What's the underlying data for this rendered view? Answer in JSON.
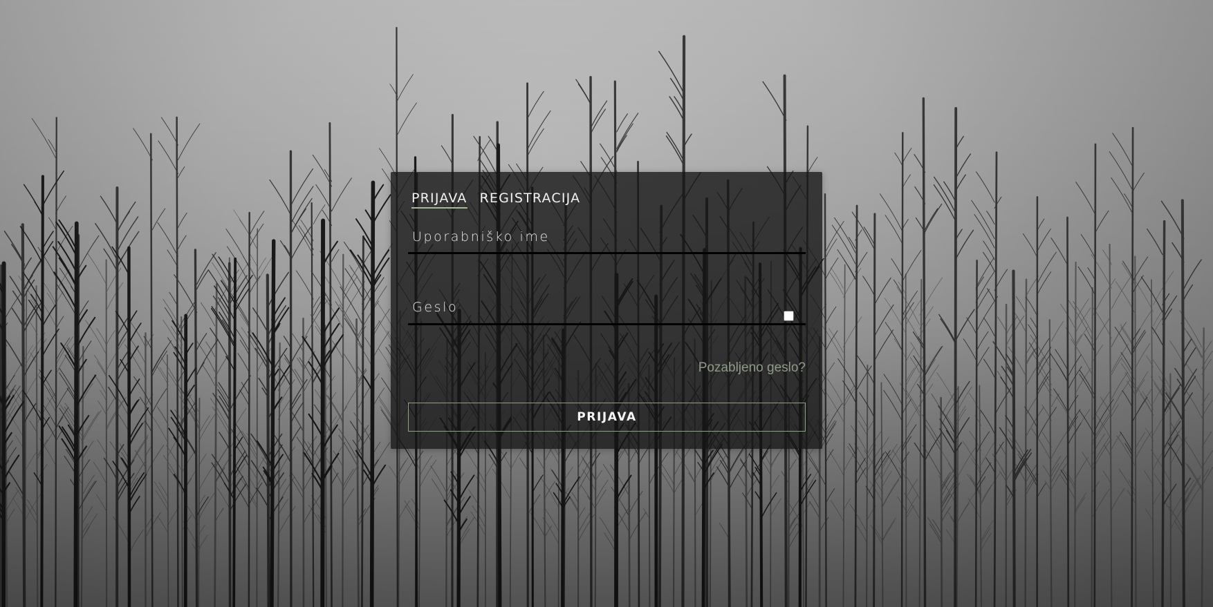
{
  "login_form": {
    "tabs": [
      {
        "label": "PRIJAVA",
        "active": true
      },
      {
        "label": "REGISTRACIJA",
        "active": false
      }
    ],
    "username": {
      "label": "Uporabniško ime",
      "value": ""
    },
    "password": {
      "label": "Geslo",
      "value": "",
      "show_password_checked": false
    },
    "forgot_password_link": "Pozabljeno geslo?",
    "submit_label": "PRIJAVA"
  },
  "colors": {
    "tab_underline": "#a7b89b",
    "link": "#8f9b87",
    "button_border": "#8fa287",
    "card_background": "#161616"
  }
}
